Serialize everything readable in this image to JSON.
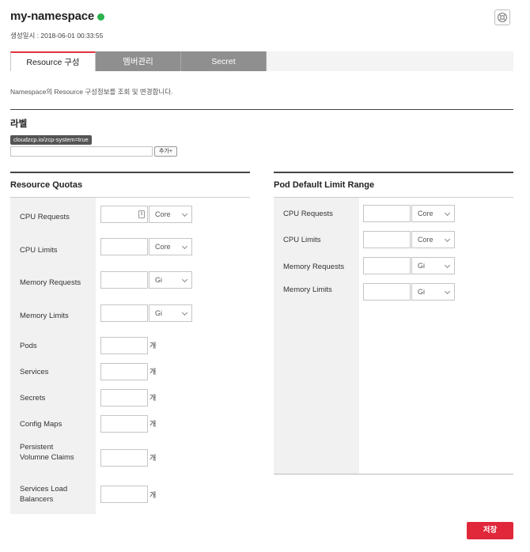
{
  "header": {
    "namespace": "my-namespace",
    "status_color": "#2bb24c",
    "created_at": "생성일시 : 2018-06-01 00:33:55",
    "help_icon": "help-icon"
  },
  "tabs": [
    {
      "label": "Resource 구성",
      "active": true
    },
    {
      "label": "멤버관리",
      "active": false
    },
    {
      "label": "Secret",
      "active": false
    }
  ],
  "description": "Namespace의 Resource 구성정보를 조회 및 변경합니다.",
  "labels": {
    "title": "라벨",
    "chips": [
      "cloudzcp.io/zcp-system=true"
    ],
    "input_value": "",
    "add_button": "추가+"
  },
  "resource_quotas": {
    "title": "Resource Quotas",
    "rows": [
      {
        "label": "CPU Requests",
        "value": "",
        "unit": "Core"
      },
      {
        "label": "CPU Limits",
        "value": "",
        "unit": "Core"
      },
      {
        "label": "Memory Requests",
        "value": "",
        "unit": "Gi"
      },
      {
        "label": "Memory Limits",
        "value": "",
        "unit": "Gi"
      },
      {
        "label": "Pods",
        "value": "",
        "unit": "개"
      },
      {
        "label": "Services",
        "value": "",
        "unit": "개"
      },
      {
        "label": "Secrets",
        "value": "",
        "unit": "개"
      },
      {
        "label": "Config Maps",
        "value": "",
        "unit": "개"
      },
      {
        "label": "Persistent Volumne Claims",
        "value": "",
        "unit": "개"
      },
      {
        "label": "Services Load Balancers",
        "value": "",
        "unit": "개"
      }
    ]
  },
  "pod_limit_range": {
    "title": "Pod Default Limit Range",
    "rows": [
      {
        "label": "CPU Requests",
        "value": "",
        "unit": "Core"
      },
      {
        "label": "CPU Limits",
        "value": "",
        "unit": "Core"
      },
      {
        "label": "Memory Requests",
        "value": "",
        "unit": "Gi"
      },
      {
        "label": "Memory Limits",
        "value": "",
        "unit": "Gi"
      }
    ]
  },
  "actions": {
    "save": "저장",
    "accent": "#e0283a"
  }
}
